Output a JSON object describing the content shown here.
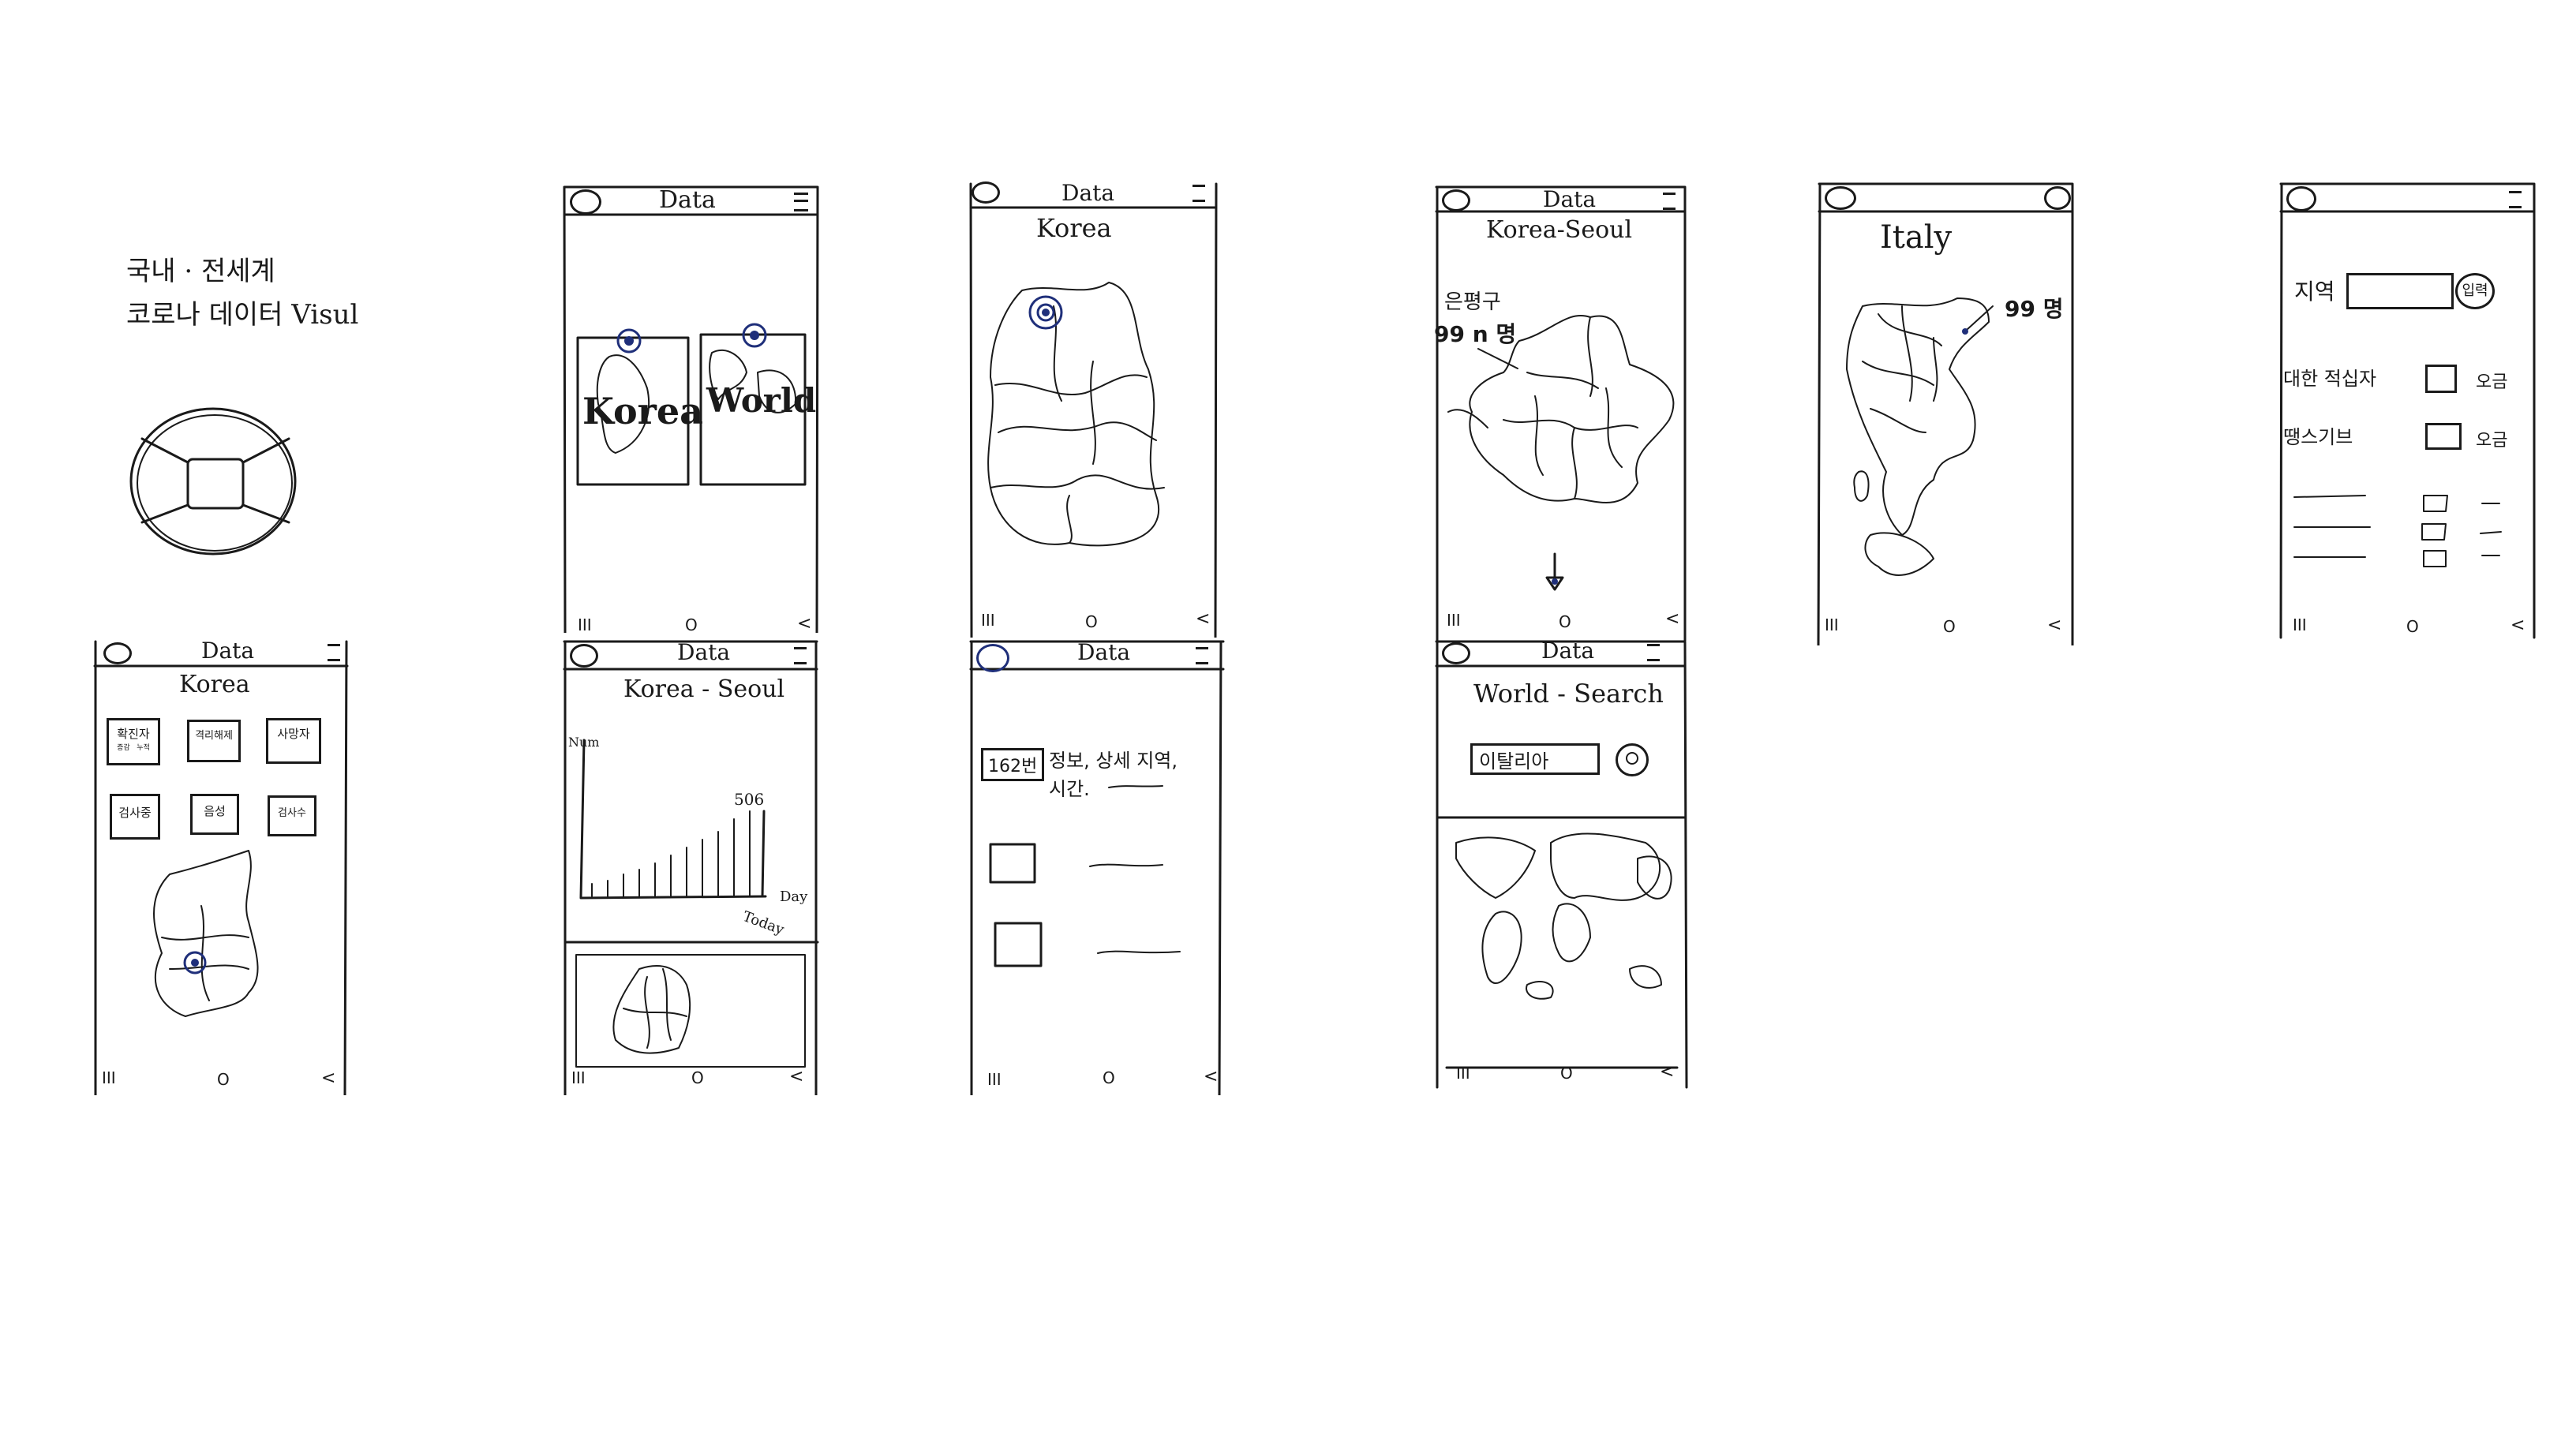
{
  "cover": {
    "title_line1": "국내 · 전세계",
    "title_line2": "코로나 데이터 Visul"
  },
  "common": {
    "app_title": "Data",
    "nav_recent": "III",
    "nav_home": "O",
    "nav_back": "<"
  },
  "s1": {
    "card_korea": "Korea",
    "card_world": "World"
  },
  "s2": {
    "title": "Korea"
  },
  "s3": {
    "title": "Korea-Seoul",
    "district": "은평구",
    "count": "99 n 명"
  },
  "s4": {
    "title": "Italy",
    "count": "99 명"
  },
  "s5": {
    "region_label": "지역",
    "enter_button": "입력",
    "rows": [
      {
        "label": "대한 적십자",
        "status": "오금"
      },
      {
        "label": "땡스기브",
        "status": "오금"
      }
    ]
  },
  "s6": {
    "title": "Korea",
    "stats": [
      "확진자",
      "격리해제",
      "사망자",
      "검사중",
      "음성",
      "검사수"
    ],
    "stat_sub": "증감   누적"
  },
  "s7": {
    "title": "Korea - Seoul",
    "chart_ylabel": "Num",
    "chart_peak": "506",
    "chart_xlabel": "Day",
    "chart_xtick": "Today"
  },
  "s8": {
    "badge": "162번",
    "info_line1": "정보, 상세 지역,",
    "info_line2": "시간."
  },
  "s9": {
    "title": "World - Search",
    "search_value": "이탈리아"
  }
}
